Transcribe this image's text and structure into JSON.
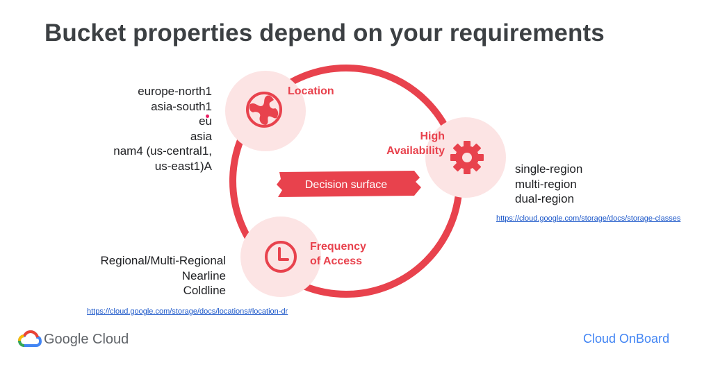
{
  "slide": {
    "title": "Bucket properties depend on your requirements"
  },
  "location": {
    "label": "Location",
    "values": [
      "europe-north1",
      "asia-south1",
      "eu",
      "asia",
      "nam4 (us-central1,",
      "us-east1)A"
    ]
  },
  "high_availability": {
    "label_line1": "High",
    "label_line2": "Availability",
    "values": [
      "single-region",
      "multi-region",
      "dual-region"
    ],
    "link": "https://cloud.google.com/storage/docs/storage-classes"
  },
  "frequency": {
    "label_line1": "Frequency",
    "label_line2": "of Access",
    "values": [
      "Regional/Multi-Regional",
      "Nearline",
      "Coldline"
    ],
    "link": "https://cloud.google.com/storage/docs/locations#location-dr"
  },
  "center": {
    "label": "Decision surface"
  },
  "footer": {
    "brand": "Google Cloud",
    "event": "Cloud OnBoard"
  },
  "colors": {
    "accent": "#e8424d",
    "bubble": "#fce4e4",
    "title": "#3c4043",
    "link": "#1a56c9",
    "onboard": "#4285f4"
  },
  "icons": {
    "location": "globe-icon",
    "high_availability": "gear-icon",
    "frequency": "clock-icon"
  }
}
